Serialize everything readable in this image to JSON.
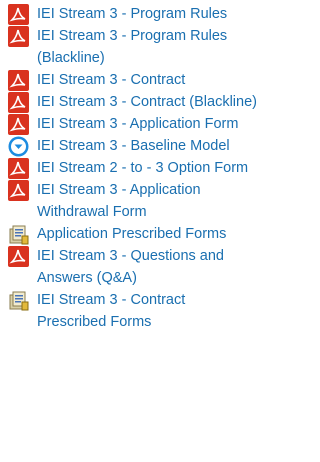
{
  "colors": {
    "link": "#1a6fb0",
    "pdf": "#d9321f",
    "download": "#1d8ce0"
  },
  "links": [
    {
      "icon": "pdf-icon",
      "label": "IEI Stream 3 - Program Rules"
    },
    {
      "icon": "pdf-icon",
      "label": "IEI Stream 3 - Program Rules (Blackline)"
    },
    {
      "icon": "pdf-icon",
      "label": "IEI Stream 3 - Contract"
    },
    {
      "icon": "pdf-icon",
      "label": "IEI Stream 3 - Contract (Blackline)"
    },
    {
      "icon": "pdf-icon",
      "label": "IEI Stream 3 - Application Form"
    },
    {
      "icon": "download-icon",
      "label": "IEI Stream 3 - Baseline Model"
    },
    {
      "icon": "pdf-icon",
      "label": "IEI Stream 2 - to - 3 Option Form"
    },
    {
      "icon": "pdf-icon",
      "label": "IEI Stream 3 - Application Withdrawal Form"
    },
    {
      "icon": "forms-icon",
      "label": "Application Prescribed Forms"
    },
    {
      "icon": "pdf-icon",
      "label": "IEI Stream 3 - Questions and Answers (Q&A)"
    },
    {
      "icon": "forms-icon",
      "label": "IEI Stream 3 - Contract Prescribed Forms"
    }
  ]
}
